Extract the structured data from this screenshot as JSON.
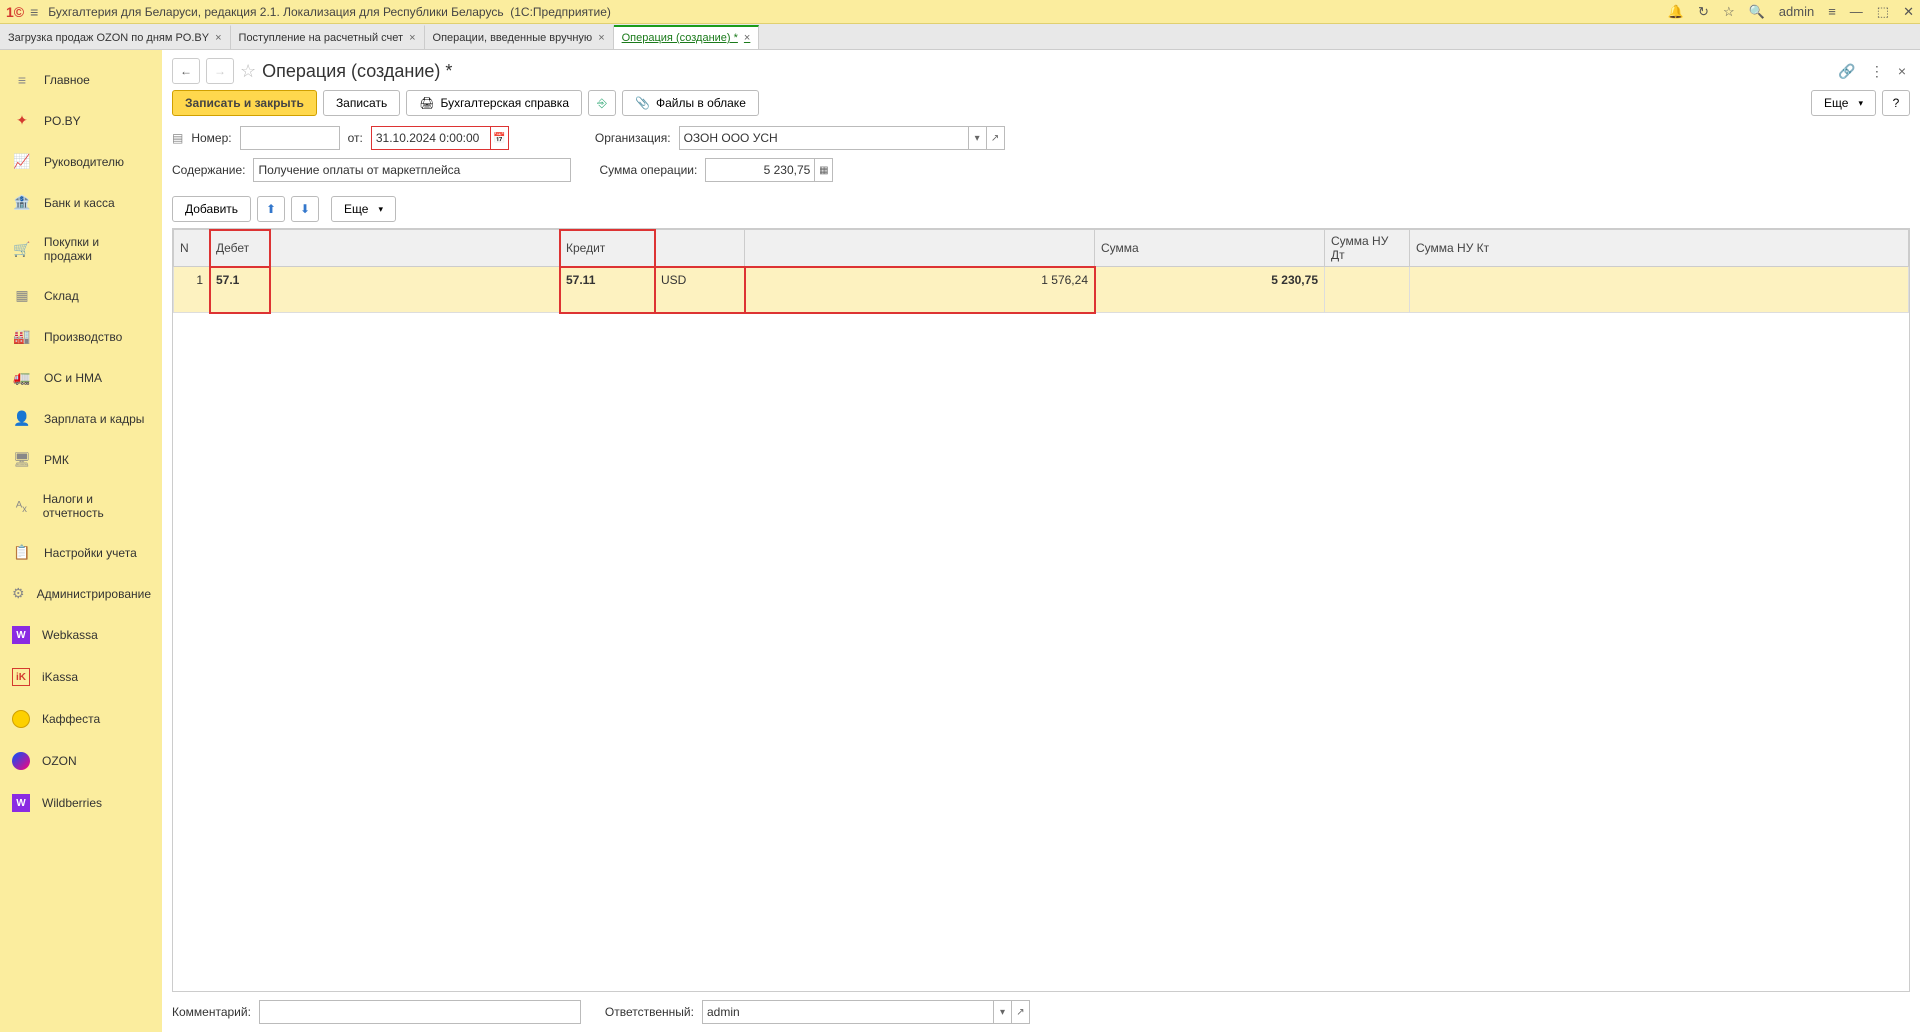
{
  "app": {
    "title": "Бухгалтерия для Беларуси, редакция 2.1. Локализация для Республики Беларусь",
    "platform": "(1С:Предприятие)",
    "user": "admin"
  },
  "tabs": [
    {
      "label": "Загрузка продаж OZON по дням PO.BY",
      "active": false
    },
    {
      "label": "Поступление на расчетный счет",
      "active": false
    },
    {
      "label": "Операции, введенные вручную",
      "active": false
    },
    {
      "label": "Операция (создание) *",
      "active": true
    }
  ],
  "sidebar": [
    {
      "icon": "≡",
      "label": "Главное"
    },
    {
      "icon": "✦",
      "label": "PO.BY"
    },
    {
      "icon": "📈",
      "label": "Руководителю"
    },
    {
      "icon": "🏦",
      "label": "Банк и касса"
    },
    {
      "icon": "🛒",
      "label": "Покупки и продажи"
    },
    {
      "icon": "▦",
      "label": "Склад"
    },
    {
      "icon": "🏭",
      "label": "Производство"
    },
    {
      "icon": "🚛",
      "label": "ОС и НМА"
    },
    {
      "icon": "👤",
      "label": "Зарплата и кадры"
    },
    {
      "icon": "🖥",
      "label": "РМК"
    },
    {
      "icon": "ᴬₓ",
      "label": "Налоги и отчетность"
    },
    {
      "icon": "📋",
      "label": "Настройки учета"
    },
    {
      "icon": "⚙",
      "label": "Администрирование"
    },
    {
      "icon": "W",
      "label": "Webkassa",
      "iconClass": "wb",
      "wb": false
    },
    {
      "icon": "iK",
      "label": "iKassa",
      "iconClass": "ik"
    },
    {
      "icon": "",
      "label": "Каффеста",
      "iconClass": "circle"
    },
    {
      "icon": "",
      "label": "OZON",
      "iconClass": "ozon"
    },
    {
      "icon": "W",
      "label": "Wildberries",
      "iconClass": "wb"
    }
  ],
  "page": {
    "title": "Операция (создание) *",
    "buttons": {
      "save_close": "Записать и закрыть",
      "save": "Записать",
      "acct_ref": "Бухгалтерская справка",
      "cloud_files": "Файлы в облаке",
      "more": "Еще",
      "help": "?",
      "add": "Добавить"
    },
    "labels": {
      "number": "Номер:",
      "from": "от:",
      "org": "Организация:",
      "content": "Содержание:",
      "opsum": "Сумма операции:",
      "comment": "Комментарий:",
      "responsible": "Ответственный:"
    },
    "fields": {
      "number": "",
      "date": "31.10.2024  0:00:00",
      "org": "ОЗОН ООО УСН",
      "content": "Получение оплаты от маркетплейса",
      "opsum": "5 230,75",
      "comment": "",
      "responsible": "admin"
    },
    "table": {
      "headers": {
        "n": "N",
        "debit": "Дебет",
        "credit": "Кредит",
        "sum": "Сумма",
        "sum_nu_dt": "Сумма НУ Дт",
        "sum_nu_kt": "Сумма НУ Кт"
      },
      "rows": [
        {
          "n": "1",
          "debit": "57.1",
          "credit": "57.11",
          "currency": "USD",
          "amount": "1 576,24",
          "sum": "5 230,75"
        }
      ]
    }
  }
}
